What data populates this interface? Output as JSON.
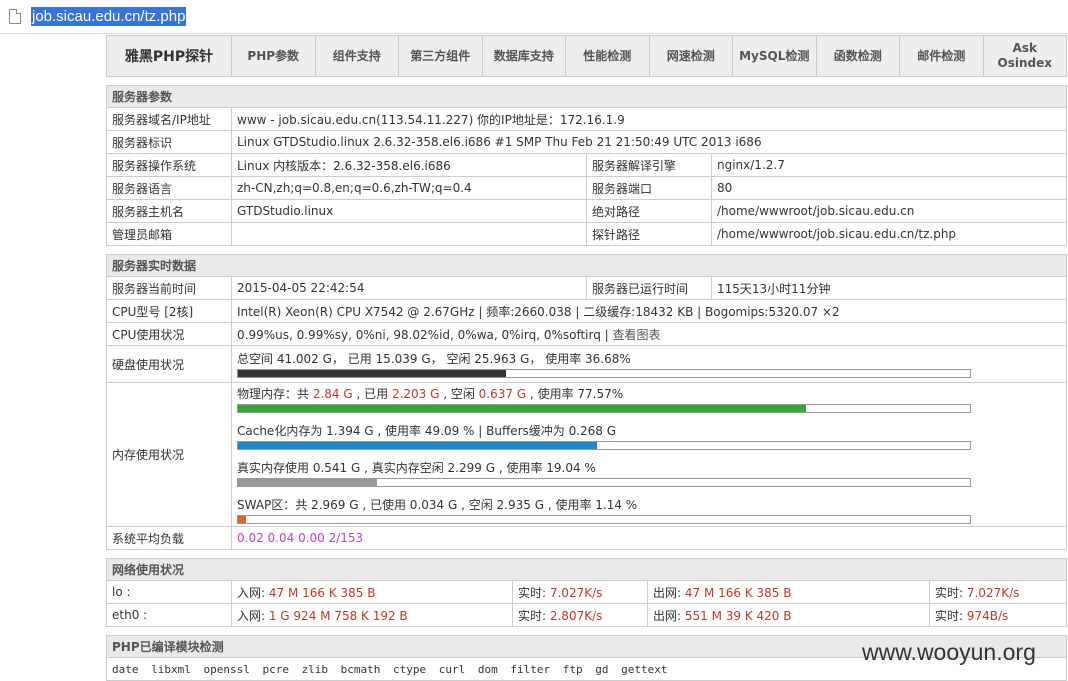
{
  "browser": {
    "url": "job.sicau.edu.cn/tz.php"
  },
  "nav": {
    "brand": "雅黑PHP探针",
    "items": [
      "PHP参数",
      "组件支持",
      "第三方组件",
      "数据库支持",
      "性能检测",
      "网速检测",
      "MySQL检测",
      "函数检测",
      "邮件检测",
      "Ask Osindex"
    ]
  },
  "server_params": {
    "title": "服务器参数",
    "domain_label": "服务器域名/IP地址",
    "domain_value": "www - job.sicau.edu.cn(113.54.11.227)  你的IP地址是：172.16.1.9",
    "id_label": "服务器标识",
    "id_value": "Linux GTDStudio.linux 2.6.32-358.el6.i686 #1 SMP Thu Feb 21 21:50:49 UTC 2013 i686",
    "os_label": "服务器操作系统",
    "os_value": "Linux  内核版本：2.6.32-358.el6.i686",
    "engine_label": "服务器解译引擎",
    "engine_value": "nginx/1.2.7",
    "lang_label": "服务器语言",
    "lang_value": "zh-CN,zh;q=0.8,en;q=0.6,zh-TW;q=0.4",
    "port_label": "服务器端口",
    "port_value": "80",
    "host_label": "服务器主机名",
    "host_value": "GTDStudio.linux",
    "abspath_label": "绝对路径",
    "abspath_value": "/home/wwwroot/job.sicau.edu.cn",
    "admin_label": "管理员邮箱",
    "admin_value": "",
    "probe_label": "探针路径",
    "probe_value": "/home/wwwroot/job.sicau.edu.cn/tz.php"
  },
  "realtime": {
    "title": "服务器实时数据",
    "time_label": "服务器当前时间",
    "time_value": "2015-04-05 22:42:54",
    "uptime_label": "服务器已运行时间",
    "uptime_value": "115天13小时11分钟",
    "cpu_label": "CPU型号 [2核]",
    "cpu_value": "Intel(R) Xeon(R) CPU X7542 @ 2.67GHz | 频率:2660.038 | 二级缓存:18432 KB | Bogomips:5320.07 ×2",
    "cpu_usage_label": "CPU使用状况",
    "cpu_usage_value": "0.99%us, 0.99%sy, 0%ni, 98.02%id, 0%wa, 0%irq, 0%softirq | ",
    "cpu_chart_link": "查看图表",
    "disk_label": "硬盘使用状况",
    "disk_value": "总空间 41.002 G， 已用 15.039 G， 空闲 25.963 G， 使用率 36.68%",
    "disk_percent": 36.68,
    "mem_label": "内存使用状况",
    "phys_prefix": "物理内存：共 ",
    "phys_total": "2.84 G",
    "phys_used_prefix": " , 已用 ",
    "phys_used": "2.203 G",
    "phys_free_prefix": " , 空闲 ",
    "phys_free": "0.637 G",
    "phys_rate": " , 使用率 77.57%",
    "phys_percent": 77.57,
    "cache_text": "Cache化内存为 1.394 G , 使用率 49.09 % | Buffers缓冲为 0.268 G",
    "cache_percent": 49.09,
    "real_text": "真实内存使用 0.541 G , 真实内存空闲 2.299 G , 使用率 19.04 %",
    "real_percent": 19.04,
    "swap_text": "SWAP区：共 2.969 G , 已使用 0.034 G , 空闲 2.935 G , 使用率 1.14 %",
    "swap_percent": 1.14,
    "load_label": "系统平均负载",
    "load_value": "0.02 0.04 0.00 2/153",
    "colors": {
      "disk": "#333333",
      "phys": "#3aa335",
      "cache": "#1e88d0",
      "real": "#999999",
      "swap": "#e0622a"
    }
  },
  "network": {
    "title": "网络使用状况",
    "rows": [
      {
        "name": "lo :",
        "in_label": "入网: ",
        "in": "47 M 166 K 385 B",
        "rt1_label": "实时: ",
        "rt1": "7.027K/s",
        "out_label": "出网: ",
        "out": "47 M 166 K 385 B",
        "rt2_label": "实时: ",
        "rt2": "7.027K/s"
      },
      {
        "name": "eth0 :",
        "in_label": "入网: ",
        "in": "1 G 924 M 758 K 192 B",
        "rt1_label": "实时: ",
        "rt1": "2.807K/s",
        "out_label": "出网: ",
        "out": "551 M 39 K 420 B",
        "rt2_label": "实时: ",
        "rt2": "974B/s"
      }
    ]
  },
  "modules": {
    "title": "PHP已编译模块检测",
    "list": "date  libxml  openssl  pcre  zlib  bcmath  ctype  curl  dom  filter  ftp  gd  gettext"
  },
  "watermark": "www.wooyun.org"
}
